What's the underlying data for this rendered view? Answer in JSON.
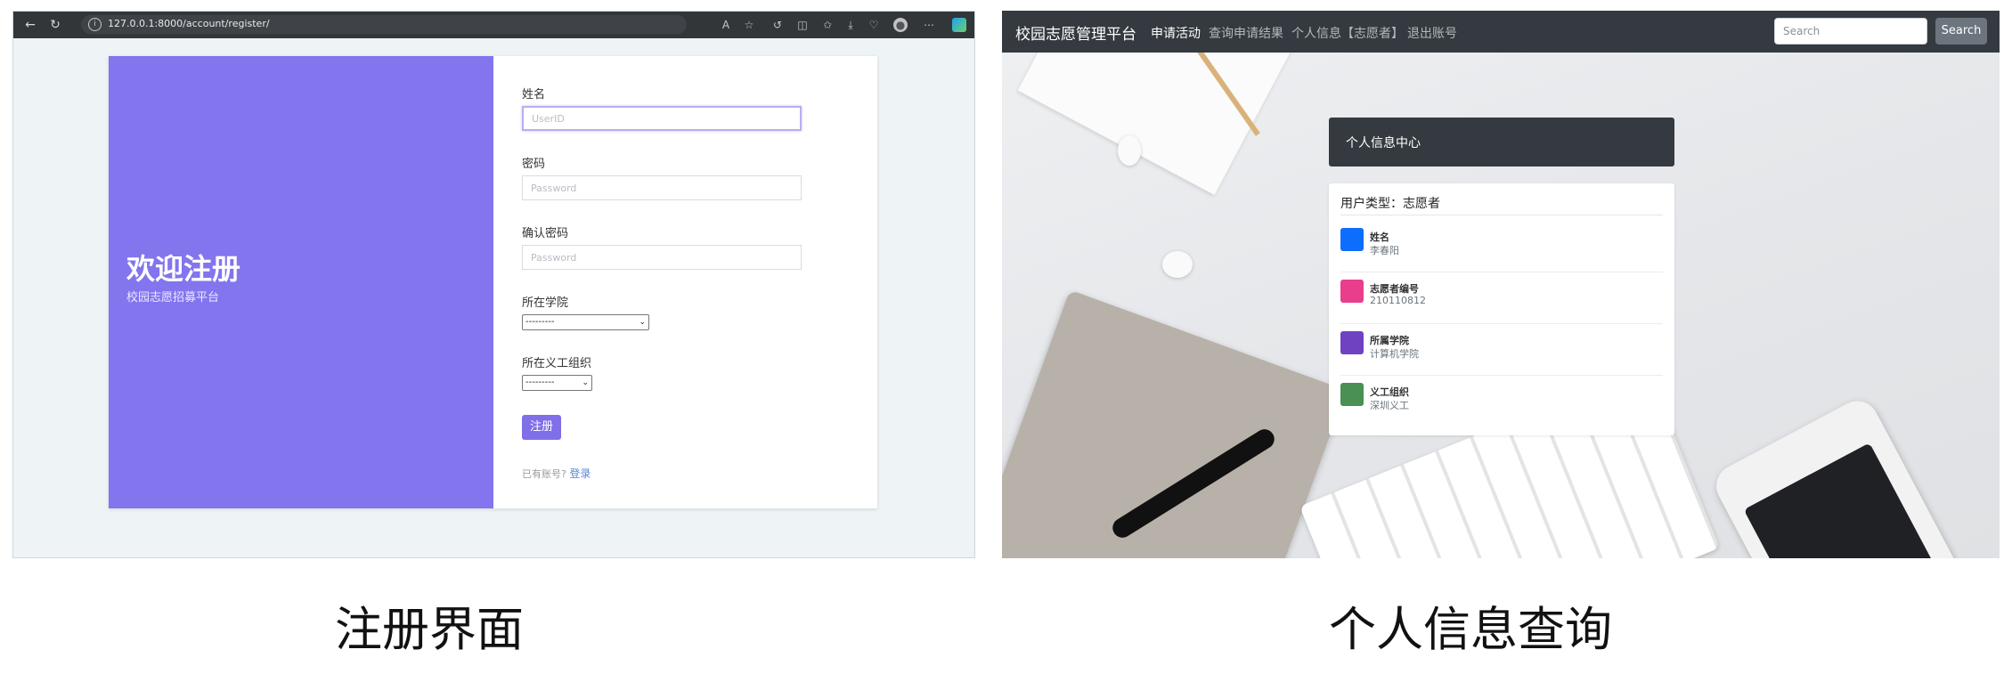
{
  "register_screen": {
    "browser": {
      "url": "127.0.0.1:8000/account/register/"
    },
    "welcome": {
      "title": "欢迎注册",
      "subtitle": "校园志愿招募平台"
    },
    "form": {
      "name_label": "姓名",
      "name_placeholder": "UserID",
      "password_label": "密码",
      "password_placeholder": "Password",
      "confirm_label": "确认密码",
      "confirm_placeholder": "Password",
      "college_label": "所在学院",
      "college_value": "---------",
      "org_label": "所在义工组织",
      "org_value": "---------",
      "submit_label": "注册",
      "have_account_text": "已有账号?",
      "login_link": "登录"
    }
  },
  "info_screen": {
    "navbar": {
      "brand": "校园志愿管理平台",
      "links": [
        "申请活动",
        "查询申请结果",
        "个人信息【志愿者】",
        "退出账号"
      ],
      "search_placeholder": "Search",
      "search_button": "Search"
    },
    "panel_header": "个人信息中心",
    "user_type": "用户类型：志愿者",
    "rows": [
      {
        "label": "姓名",
        "value": "李春阳",
        "color": "#0d6efd"
      },
      {
        "label": "志愿者编号",
        "value": "210110812",
        "color": "#e83e8c"
      },
      {
        "label": "所属学院",
        "value": "计算机学院",
        "color": "#6f42c1"
      },
      {
        "label": "义工组织",
        "value": "深圳义工",
        "color": "#4a8f54"
      }
    ]
  },
  "captions": {
    "left": "注册界面",
    "right": "个人信息查询"
  }
}
